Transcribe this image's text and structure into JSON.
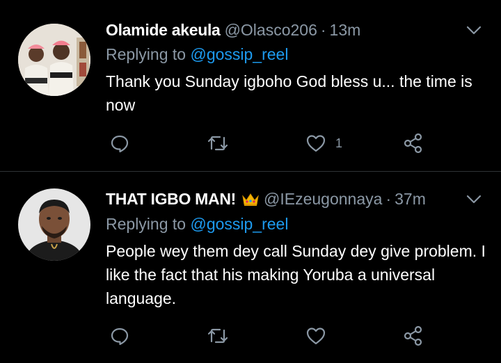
{
  "colors": {
    "background": "#000000",
    "secondary_text": "#8b98a5",
    "link": "#1d9bf0",
    "divider": "#2f3336",
    "icon": "#8b98a5"
  },
  "tweets": [
    {
      "display_name": "Olamide akeula",
      "handle": "@Olasco206",
      "separator": "·",
      "time": "13m",
      "reply_prefix": "Replying to",
      "reply_mention": "@gossip_reel",
      "text": "Thank you Sunday igboho God bless u... the time is now",
      "like_count": "1",
      "icons": [
        "avatar",
        "chevron-down-icon",
        "reply-icon",
        "retweet-icon",
        "like-icon",
        "share-icon"
      ]
    },
    {
      "display_name": "THAT IGBO MAN!",
      "display_name_emoji": "crown-emoji",
      "handle": "@IEzeugonnaya",
      "separator": "·",
      "time": "37m",
      "reply_prefix": "Replying to",
      "reply_mention": "@gossip_reel",
      "text": "People wey them dey call Sunday dey give problem. I like the fact that his making Yoruba a universal language.",
      "like_count": "",
      "icons": [
        "avatar",
        "chevron-down-icon",
        "reply-icon",
        "retweet-icon",
        "like-icon",
        "share-icon"
      ]
    }
  ]
}
